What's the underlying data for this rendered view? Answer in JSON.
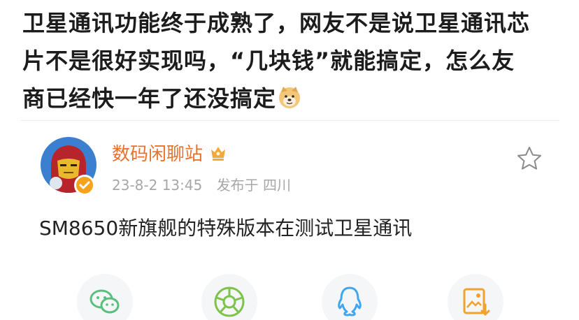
{
  "headline": {
    "line1": "卫星通讯功能终于成熟了，网友不是说卫星通讯芯",
    "line2": "片不是很好实现吗，“几块钱”就能搞定，怎么友",
    "line3": "商已经快一年了还没搞定"
  },
  "post": {
    "username": "数码闲聊站",
    "date": "23-8-2 13:45",
    "location": "发布于 四川",
    "body": "SM8650新旗舰的特殊版本在测试卫星通讯"
  },
  "colors": {
    "username": "#e8712e",
    "meta": "#a7a7a7",
    "wechat": "#58c07a",
    "moments": "#7cc24b",
    "qq": "#3fa7f2",
    "save": "#f1a22c"
  },
  "icons": {
    "emoji": "doge-emoji-icon",
    "verified": "verified-badge-icon",
    "vip": "vip-crown-icon",
    "favorite": "star-icon",
    "share": [
      "wechat-icon",
      "moments-icon",
      "qq-icon",
      "save-image-icon"
    ]
  }
}
